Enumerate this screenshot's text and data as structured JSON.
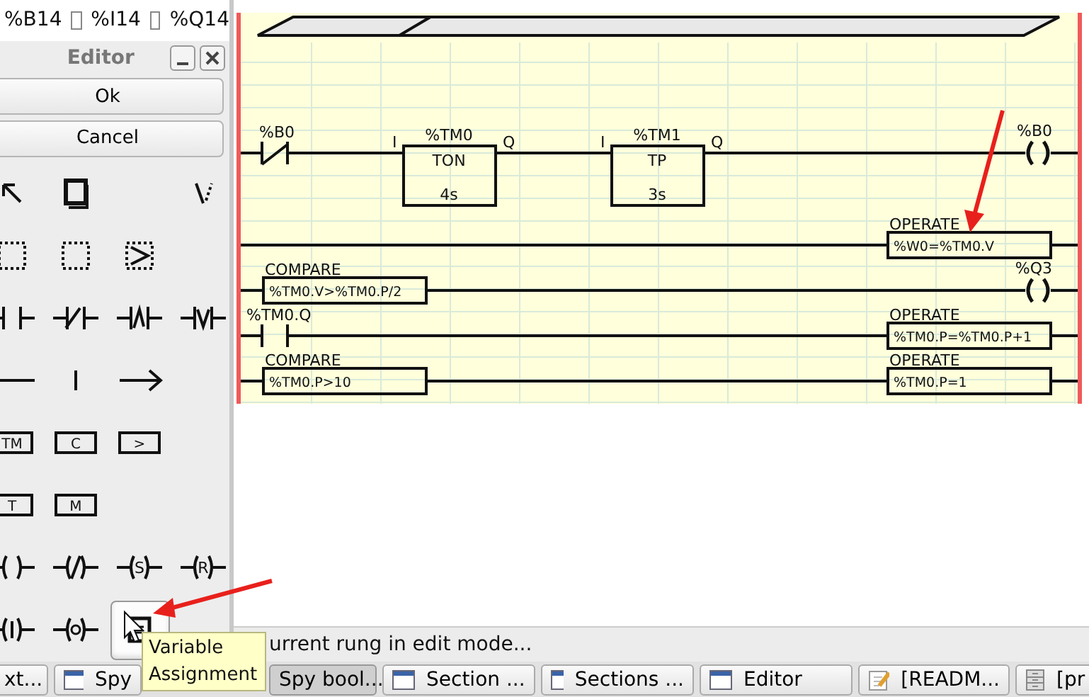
{
  "top_bar": {
    "items": [
      {
        "label": "%B14",
        "checked": false
      },
      {
        "label": "%I14",
        "checked": false
      },
      {
        "label": "%Q14"
      }
    ]
  },
  "editor": {
    "title": "Editor",
    "buttons": [
      "Ok",
      "Cancel"
    ],
    "tools": [
      {
        "kind": "pointer",
        "selected": false
      },
      {
        "kind": "block",
        "selected": false
      },
      {
        "kind": "wire-tool",
        "selected": false
      },
      {
        "kind": "select",
        "selected": false
      },
      {
        "kind": "select",
        "selected": false
      },
      {
        "kind": "select-arrow",
        "selected": false
      },
      {
        "kind": "contact-open",
        "selected": false
      },
      {
        "kind": "contact-closed",
        "selected": false
      },
      {
        "kind": "contact-rising",
        "selected": false
      },
      {
        "kind": "contact-falling",
        "selected": false
      },
      {
        "kind": "h-line",
        "selected": false
      },
      {
        "kind": "v-line",
        "selected": false
      },
      {
        "kind": "arrow",
        "selected": false
      },
      {
        "kind": "box",
        "label": "TM",
        "selected": false
      },
      {
        "kind": "box",
        "label": "C",
        "selected": false
      },
      {
        "kind": "box",
        "label": ">",
        "selected": false
      },
      {
        "kind": "box",
        "label": "T",
        "selected": false
      },
      {
        "kind": "box",
        "label": "M",
        "selected": false
      },
      {
        "kind": "coil",
        "selected": false
      },
      {
        "kind": "coil-negated",
        "selected": false
      },
      {
        "kind": "coil-letter",
        "label": "S",
        "selected": false
      },
      {
        "kind": "coil-letter",
        "label": "R",
        "selected": false
      },
      {
        "kind": "coil-bar",
        "selected": false
      },
      {
        "kind": "coil-circle",
        "selected": false
      },
      {
        "kind": "assign",
        "selected": true
      }
    ],
    "tooltip": "Variable Assignment"
  },
  "ladder": {
    "rungs": [
      {
        "inputs": [
          {
            "kind": "contact_nc",
            "label": "%B0"
          },
          {
            "kind": "timer",
            "label": "%TM0",
            "type": "TON",
            "preset": "4s",
            "pin_in": "I",
            "pin_out": "Q"
          },
          {
            "kind": "timer",
            "label": "%TM1",
            "type": "TP",
            "preset": "3s",
            "pin_in": "I",
            "pin_out": "Q"
          }
        ],
        "output": {
          "kind": "coil",
          "label": "%B0"
        }
      },
      {
        "output": {
          "kind": "operate",
          "label": "OPERATE",
          "expr": "%W0=%TM0.V"
        }
      },
      {
        "inputs": [
          {
            "kind": "compare",
            "label": "COMPARE",
            "expr": "%TM0.V>%TM0.P/2"
          }
        ],
        "output": {
          "kind": "coil",
          "label": "%Q3"
        }
      },
      {
        "inputs": [
          {
            "kind": "contact_no",
            "label": "%TM0.Q"
          }
        ],
        "output": {
          "kind": "operate",
          "label": "OPERATE",
          "expr": "%TM0.P=%TM0.P+1"
        }
      },
      {
        "inputs": [
          {
            "kind": "compare",
            "label": "COMPARE",
            "expr": "%TM0.P>10"
          }
        ],
        "output": {
          "kind": "operate",
          "label": "OPERATE",
          "expr": "%TM0.P=1"
        }
      }
    ]
  },
  "status_bar": "urrent rung in edit mode...",
  "taskbar": [
    {
      "label": "xt...",
      "selected": false
    },
    {
      "label": "Spy",
      "selected": false
    },
    {
      "label": "Spy bool...",
      "selected": true
    },
    {
      "label": "Section ...",
      "selected": false
    },
    {
      "label": "Sections ...",
      "selected": false
    },
    {
      "label": "Editor",
      "selected": false
    },
    {
      "label": "[READM...",
      "selected": false
    },
    {
      "label": "[pr",
      "selected": false
    }
  ]
}
